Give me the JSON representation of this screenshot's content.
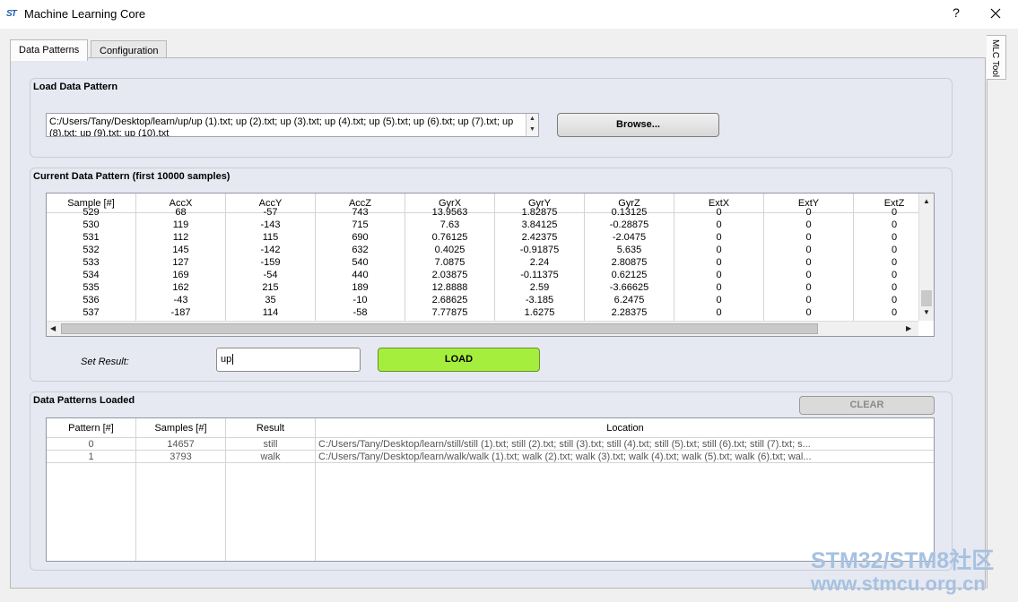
{
  "window": {
    "icon": "ST",
    "title": "Machine Learning Core",
    "help": "?"
  },
  "tabs": [
    {
      "label": "Data Patterns"
    },
    {
      "label": "Configuration"
    }
  ],
  "side_tab": "MLC Tool",
  "load_section": {
    "title": "Load Data Pattern",
    "path_value": "C:/Users/Tany/Desktop/learn/up/up (1).txt; up (2).txt; up (3).txt; up (4).txt; up (5).txt; up (6).txt; up (7).txt; up (8).txt; up (9).txt; up (10).txt",
    "browse_label": "Browse..."
  },
  "current_section": {
    "title": "Current Data Pattern (first 10000 samples)",
    "columns": [
      "Sample [#]",
      "AccX",
      "AccY",
      "AccZ",
      "GyrX",
      "GyrY",
      "GyrZ",
      "ExtX",
      "ExtY",
      "ExtZ"
    ],
    "rows": [
      [
        "529",
        "68",
        "-57",
        "743",
        "13.9563",
        "1.82875",
        "0.13125",
        "0",
        "0",
        "0"
      ],
      [
        "530",
        "119",
        "-143",
        "715",
        "7.63",
        "3.84125",
        "-0.28875",
        "0",
        "0",
        "0"
      ],
      [
        "531",
        "112",
        "115",
        "690",
        "0.76125",
        "2.42375",
        "-2.0475",
        "0",
        "0",
        "0"
      ],
      [
        "532",
        "145",
        "-142",
        "632",
        "0.4025",
        "-0.91875",
        "5.635",
        "0",
        "0",
        "0"
      ],
      [
        "533",
        "127",
        "-159",
        "540",
        "7.0875",
        "2.24",
        "2.80875",
        "0",
        "0",
        "0"
      ],
      [
        "534",
        "169",
        "-54",
        "440",
        "2.03875",
        "-0.11375",
        "0.62125",
        "0",
        "0",
        "0"
      ],
      [
        "535",
        "162",
        "215",
        "189",
        "12.8888",
        "2.59",
        "-3.66625",
        "0",
        "0",
        "0"
      ],
      [
        "536",
        "-43",
        "35",
        "-10",
        "2.68625",
        "-3.185",
        "6.2475",
        "0",
        "0",
        "0"
      ],
      [
        "537",
        "-187",
        "114",
        "-58",
        "7.77875",
        "1.6275",
        "2.28375",
        "0",
        "0",
        "0"
      ]
    ],
    "set_result_label": "Set Result:",
    "result_value": "up",
    "load_label": "LOAD"
  },
  "loaded_section": {
    "title": "Data Patterns Loaded",
    "clear_label": "CLEAR",
    "columns": [
      "Pattern [#]",
      "Samples [#]",
      "Result",
      "Location"
    ],
    "rows": [
      [
        "0",
        "14657",
        "still",
        "C:/Users/Tany/Desktop/learn/still/still (1).txt; still (2).txt; still (3).txt; still (4).txt; still (5).txt; still (6).txt; still (7).txt; s..."
      ],
      [
        "1",
        "3793",
        "walk",
        "C:/Users/Tany/Desktop/learn/walk/walk (1).txt; walk (2).txt; walk (3).txt; walk (4).txt; walk (5).txt; walk (6).txt; wal..."
      ]
    ]
  },
  "watermark": {
    "line1": "STM32/STM8社区",
    "line2": "www.stmcu.org.cn"
  },
  "colors": {
    "load_button": "#a5ee3d",
    "pane_background": "#e6e9f2"
  }
}
